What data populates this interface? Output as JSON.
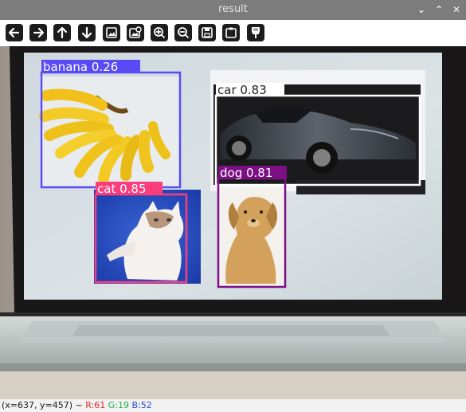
{
  "window": {
    "title": "result",
    "controls": {
      "minimize": "⌄",
      "maximize": "⌃",
      "close": "✕"
    }
  },
  "toolbar": {
    "buttons": [
      {
        "name": "pan-left-button",
        "icon": "arrow-left-icon"
      },
      {
        "name": "pan-right-button",
        "icon": "arrow-right-icon"
      },
      {
        "name": "pan-up-button",
        "icon": "arrow-up-icon"
      },
      {
        "name": "pan-down-button",
        "icon": "arrow-down-icon"
      },
      {
        "name": "zoom-fit-button",
        "icon": "image-icon"
      },
      {
        "name": "zoom-original-button",
        "icon": "image-zoom-icon"
      },
      {
        "name": "zoom-in-button",
        "icon": "zoom-in-icon"
      },
      {
        "name": "zoom-out-button",
        "icon": "zoom-out-icon"
      },
      {
        "name": "save-button",
        "icon": "save-icon"
      },
      {
        "name": "copy-button",
        "icon": "clipboard-icon"
      },
      {
        "name": "properties-button",
        "icon": "brush-icon"
      }
    ]
  },
  "detections": [
    {
      "label": "banana 0.26",
      "color": "#5a4af6"
    },
    {
      "label": "car 0.83",
      "color": "#ffffff"
    },
    {
      "label": "cat 0.85",
      "color": "#fb3d7c"
    },
    {
      "label": "dog 0.81",
      "color": "#7b0f83"
    }
  ],
  "status": {
    "coords": "(x=637, y=457) ~",
    "r": "R:61",
    "g": "G:19",
    "b": "B:52",
    "colors": {
      "r": "#e8262d",
      "g": "#21b14a",
      "b": "#2747d9"
    }
  }
}
